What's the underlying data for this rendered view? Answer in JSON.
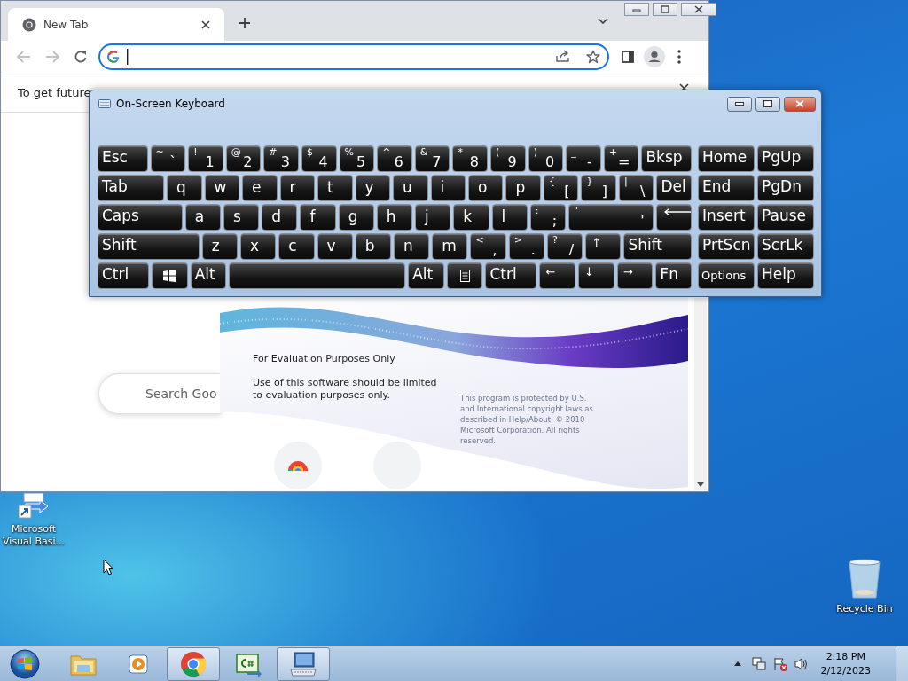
{
  "browser": {
    "tab": {
      "title": "New Tab"
    },
    "infobar": {
      "text": "To get future"
    },
    "search": {
      "placeholder": "Search Goo"
    }
  },
  "keyboard": {
    "title": "On-Screen Keyboard",
    "rows": [
      {
        "keys": [
          {
            "kind": "command",
            "label": "Esc"
          },
          {
            "kind": "dual",
            "shift": "~",
            "label": "`"
          },
          {
            "kind": "dual",
            "shift": "!",
            "label": "1"
          },
          {
            "kind": "dual",
            "shift": "@",
            "label": "2"
          },
          {
            "kind": "dual",
            "shift": "#",
            "label": "3"
          },
          {
            "kind": "dual",
            "shift": "$",
            "label": "4"
          },
          {
            "kind": "dual",
            "shift": "%",
            "label": "5"
          },
          {
            "kind": "dual",
            "shift": "^",
            "label": "6"
          },
          {
            "kind": "dual",
            "shift": "&",
            "label": "7"
          },
          {
            "kind": "dual",
            "shift": "*",
            "label": "8"
          },
          {
            "kind": "dual",
            "shift": "(",
            "label": "9"
          },
          {
            "kind": "dual",
            "shift": ")",
            "label": "0"
          },
          {
            "kind": "dual",
            "shift": "_",
            "label": "-"
          },
          {
            "kind": "dual",
            "shift": "+",
            "label": "="
          },
          {
            "kind": "command",
            "label": "Bksp"
          }
        ]
      },
      {
        "keys": [
          {
            "kind": "command",
            "label": "Tab"
          },
          {
            "kind": "letter",
            "label": "q"
          },
          {
            "kind": "letter",
            "label": "w"
          },
          {
            "kind": "letter",
            "label": "e"
          },
          {
            "kind": "letter",
            "label": "r"
          },
          {
            "kind": "letter",
            "label": "t"
          },
          {
            "kind": "letter",
            "label": "y"
          },
          {
            "kind": "letter",
            "label": "u"
          },
          {
            "kind": "letter",
            "label": "i"
          },
          {
            "kind": "letter",
            "label": "o"
          },
          {
            "kind": "letter",
            "label": "p"
          },
          {
            "kind": "dual",
            "shift": "{",
            "label": "["
          },
          {
            "kind": "dual",
            "shift": "}",
            "label": "]"
          },
          {
            "kind": "dual",
            "shift": "|",
            "label": "\\"
          },
          {
            "kind": "command",
            "label": "Del"
          }
        ]
      },
      {
        "keys": [
          {
            "kind": "command",
            "label": "Caps"
          },
          {
            "kind": "letter",
            "label": "a"
          },
          {
            "kind": "letter",
            "label": "s"
          },
          {
            "kind": "letter",
            "label": "d"
          },
          {
            "kind": "letter",
            "label": "f"
          },
          {
            "kind": "letter",
            "label": "g"
          },
          {
            "kind": "letter",
            "label": "h"
          },
          {
            "kind": "letter",
            "label": "j"
          },
          {
            "kind": "letter",
            "label": "k"
          },
          {
            "kind": "letter",
            "label": "l"
          },
          {
            "kind": "dual",
            "shift": ":",
            "label": ";"
          },
          {
            "kind": "dual",
            "shift": "\"",
            "label": "'"
          },
          {
            "kind": "enter"
          }
        ]
      },
      {
        "keys": [
          {
            "kind": "command",
            "label": "Shift"
          },
          {
            "kind": "letter",
            "label": "z"
          },
          {
            "kind": "letter",
            "label": "x"
          },
          {
            "kind": "letter",
            "label": "c"
          },
          {
            "kind": "letter",
            "label": "v"
          },
          {
            "kind": "letter",
            "label": "b"
          },
          {
            "kind": "letter",
            "label": "n"
          },
          {
            "kind": "letter",
            "label": "m"
          },
          {
            "kind": "dual",
            "shift": "<",
            "label": ","
          },
          {
            "kind": "dual",
            "shift": ">",
            "label": "."
          },
          {
            "kind": "dual",
            "shift": "?",
            "label": "/"
          },
          {
            "kind": "arrow",
            "label": "↑"
          },
          {
            "kind": "command",
            "label": "Shift"
          }
        ]
      },
      {
        "keys": [
          {
            "kind": "command",
            "label": "Ctrl"
          },
          {
            "kind": "windows"
          },
          {
            "kind": "command",
            "label": "Alt"
          },
          {
            "kind": "space"
          },
          {
            "kind": "command",
            "label": "Alt"
          },
          {
            "kind": "menu"
          },
          {
            "kind": "command",
            "label": "Ctrl"
          },
          {
            "kind": "arrow",
            "label": "←"
          },
          {
            "kind": "arrow",
            "label": "↓"
          },
          {
            "kind": "arrow",
            "label": "→"
          },
          {
            "kind": "command",
            "label": "Fn"
          }
        ]
      }
    ],
    "nav_rows": [
      {
        "keys": [
          {
            "kind": "command",
            "label": "Home"
          },
          {
            "kind": "command",
            "label": "PgUp"
          }
        ]
      },
      {
        "keys": [
          {
            "kind": "command",
            "label": "End"
          },
          {
            "kind": "command",
            "label": "PgDn"
          }
        ]
      },
      {
        "keys": [
          {
            "kind": "command",
            "label": "Insert"
          },
          {
            "kind": "command",
            "label": "Pause"
          }
        ]
      },
      {
        "keys": [
          {
            "kind": "command",
            "label": "PrtScn"
          },
          {
            "kind": "command",
            "label": "ScrLk"
          }
        ]
      },
      {
        "keys": [
          {
            "kind": "compact",
            "label": "Options"
          },
          {
            "kind": "command",
            "label": "Help"
          }
        ]
      }
    ]
  },
  "splash": {
    "heading": "For Evaluation Purposes Only",
    "notice": "Use of this software should be limited to evaluation purposes only.",
    "legal": "This program is protected by U.S. and International copyright laws as described in Help/About. © 2010 Microsoft Corporation. All rights reserved."
  },
  "desktop_icons": [
    {
      "kind": "shortcut",
      "label": "Microsoft Visual Basi..."
    },
    {
      "kind": "recycle-bin",
      "label": "Recycle Bin"
    }
  ],
  "taskbar": {
    "buttons": [
      {
        "kind": "start",
        "running": false
      },
      {
        "kind": "folder",
        "running": false
      },
      {
        "kind": "media",
        "running": false
      },
      {
        "kind": "browser",
        "running": true
      },
      {
        "kind": "csharp",
        "running": false
      },
      {
        "kind": "keyboard",
        "running": true
      }
    ],
    "clock": {
      "time": "2:18 PM",
      "date": "2/12/2023"
    }
  }
}
